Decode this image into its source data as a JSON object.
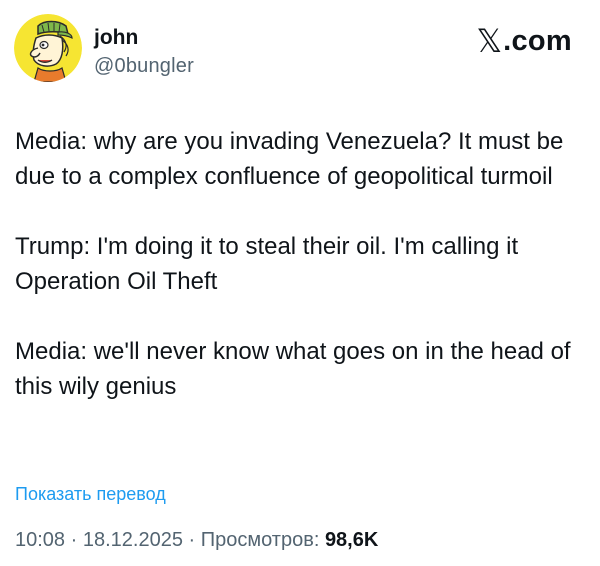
{
  "brand": {
    "glyph": "𝕏",
    "text": ".com"
  },
  "author": {
    "display_name": "john",
    "handle": "@0bungler",
    "avatar_icon": "cartoon-face-avatar"
  },
  "tweet": {
    "paragraphs": [
      "Media: why are you invading Venezuela? It must be due to a complex confluence of geopolitical turmoil",
      "Trump: I'm doing it to steal their oil. I'm calling it Operation Oil Theft",
      "Media: we'll never know what goes on in the head of this wily genius"
    ]
  },
  "translate_label": "Показать перевод",
  "meta": {
    "time": "10:08",
    "separator": " · ",
    "date": "18.12.2025",
    "views_label": "Просмотров: ",
    "views_count": "98,6K"
  },
  "colors": {
    "text": "#0f1419",
    "secondary": "#536471",
    "link": "#1d9bf0",
    "avatar_bg": "#f6e532"
  }
}
